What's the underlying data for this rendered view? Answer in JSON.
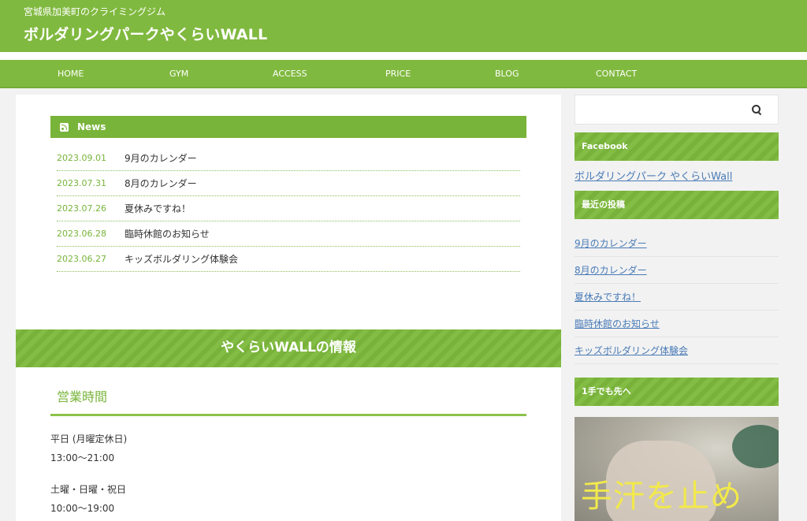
{
  "header": {
    "tagline": "宮城県加美町のクライミングジム",
    "title": "ボルダリングパークやくらいWALL"
  },
  "nav": [
    "HOME",
    "GYM",
    "ACCESS",
    "PRICE",
    "BLOG",
    "CONTACT"
  ],
  "news": {
    "heading": "News",
    "items": [
      {
        "date": "2023.09.01",
        "title": "9月のカレンダー"
      },
      {
        "date": "2023.07.31",
        "title": "8月のカレンダー"
      },
      {
        "date": "2023.07.26",
        "title": "夏休みですね！"
      },
      {
        "date": "2023.06.28",
        "title": "臨時休館のお知らせ"
      },
      {
        "date": "2023.06.27",
        "title": "キッズボルダリング体験会"
      }
    ]
  },
  "info": {
    "band_title": "やくらいWALLの情報",
    "hours_title": "営業時間",
    "weekday_label": "平日 (月曜定休日)",
    "weekday_hours": "13:00～21:00",
    "weekend_label": "土曜・日曜・祝日",
    "weekend_hours": "10:00～19:00"
  },
  "sidebar": {
    "search_placeholder": "",
    "facebook_heading": "Facebook",
    "facebook_link": "ボルダリングパーク やくらいWall",
    "recent_heading": "最近の投稿",
    "recent_posts": [
      "9月のカレンダー",
      "8月のカレンダー",
      "夏休みですね！",
      "臨時休館のお知らせ",
      "キッズボルダリング体験会"
    ],
    "ad_heading": "1手でも先へ",
    "ad_text": "手汗を止め"
  },
  "colors": {
    "accent": "#80b93f",
    "date": "#78b43a",
    "link": "#4a7bb7"
  }
}
